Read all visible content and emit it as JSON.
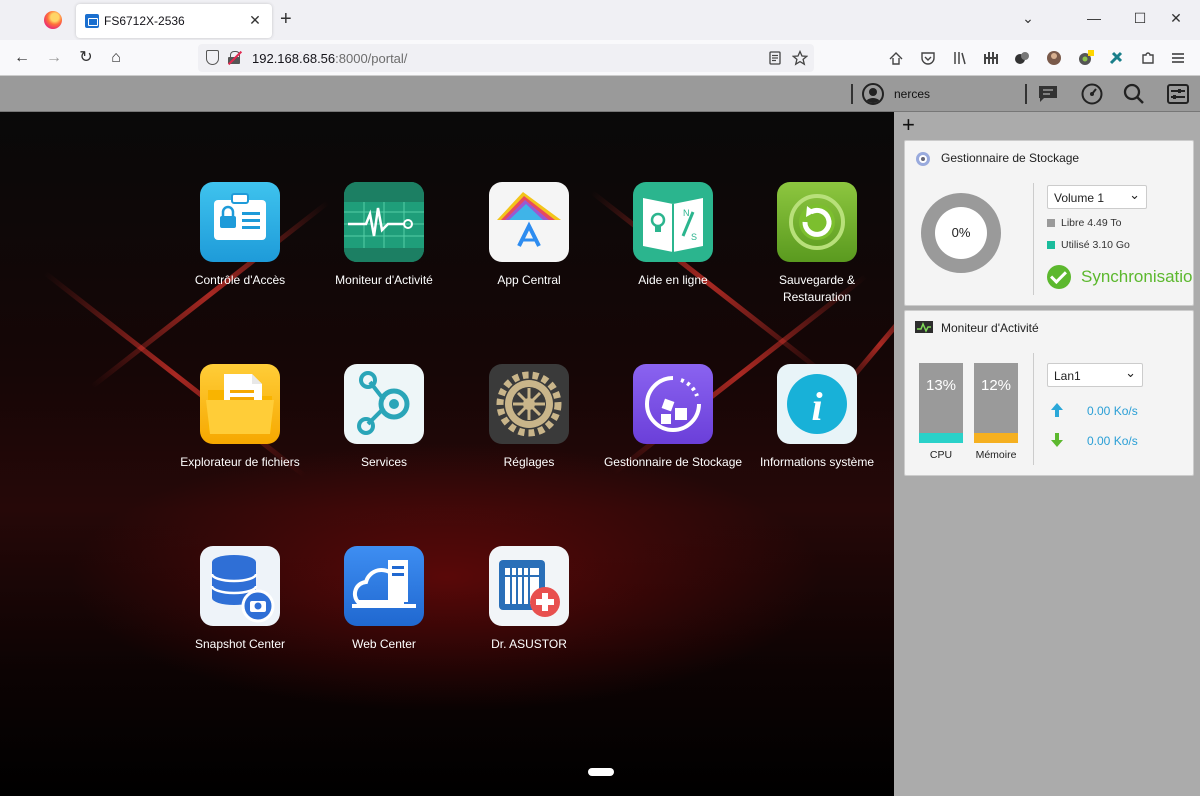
{
  "browser": {
    "tab_title": "FS6712X-2536",
    "tab_close": "✕",
    "new_tab": "+",
    "url_host": "192.168.68.56",
    "url_rest": ":8000/portal/",
    "win_min": "⌄",
    "win_minimize": "—",
    "win_maximize": "☐",
    "win_close": "✕",
    "nav_back": "←",
    "nav_forward": "→",
    "nav_reload": "↻",
    "nav_home": "⌂"
  },
  "portal": {
    "username": "nerces",
    "add_widget": "+",
    "apps": [
      {
        "label": "Contrôle d'Accès",
        "icon": "access-control-icon"
      },
      {
        "label": "Moniteur d'Activité",
        "icon": "activity-monitor-icon"
      },
      {
        "label": "App Central",
        "icon": "app-central-icon"
      },
      {
        "label": "Aide en ligne",
        "icon": "online-help-icon"
      },
      {
        "label": "Sauvegarde & Restauration",
        "icon": "backup-restore-icon"
      },
      {
        "label": "Explorateur de fichiers",
        "icon": "file-explorer-icon"
      },
      {
        "label": "Services",
        "icon": "services-icon"
      },
      {
        "label": "Réglages",
        "icon": "settings-gear-icon"
      },
      {
        "label": "Gestionnaire de Stockage",
        "icon": "storage-manager-icon"
      },
      {
        "label": "Informations système",
        "icon": "system-info-icon"
      },
      {
        "label": "Snapshot Center",
        "icon": "snapshot-center-icon"
      },
      {
        "label": "Web Center",
        "icon": "web-center-icon"
      },
      {
        "label": "Dr. ASUSTOR",
        "icon": "dr-asustor-icon"
      }
    ],
    "storage_widget": {
      "title": "Gestionnaire de Stockage",
      "volume": "Volume 1",
      "used_percent": "0%",
      "free": "Libre 4.49 To",
      "used": "Utilisé 3.10 Go",
      "status": "Synchronisation",
      "colors": {
        "free": "#9a9a9a",
        "used": "#1abc9c",
        "status": "#5cb82e"
      }
    },
    "activity_widget": {
      "title": "Moniteur d'Activité",
      "cpu_percent": "13%",
      "cpu_label": "CPU",
      "mem_percent": "12%",
      "mem_label": "Mémoire",
      "interface": "Lan1",
      "upload": "0.00 Ko/s",
      "download": "0.00 Ko/s",
      "cpu_value": 0.13,
      "mem_value": 0.12,
      "colors": {
        "cpu": "#2ad1c9",
        "mem": "#f5b020",
        "net": "#2a9fd6"
      }
    }
  }
}
